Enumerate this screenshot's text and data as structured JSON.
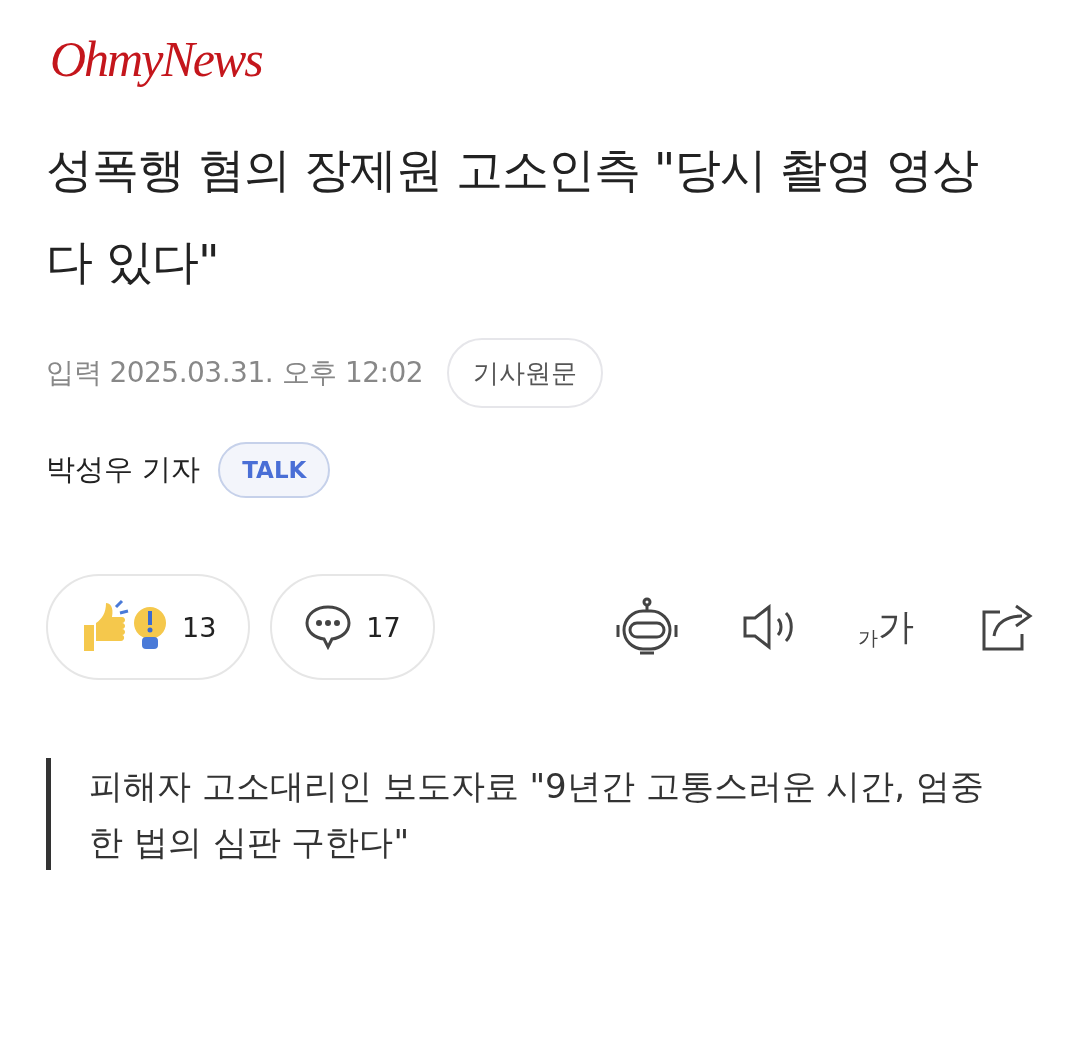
{
  "logo": "OhmyNews",
  "headline": "성폭행 혐의 장제원 고소인측 \"당시 촬영 영상 다 있다\"",
  "meta": {
    "published": "입력 2025.03.31. 오후 12:02",
    "original_button": "기사원문"
  },
  "byline": {
    "author": "박성우 기자",
    "talk_button": "TALK"
  },
  "actions": {
    "reactions": "13",
    "comments": "17",
    "font_size": {
      "small": "가",
      "large": "가"
    }
  },
  "subtitle": "피해자 고소대리인 보도자료 \"9년간 고통스러운 시간, 엄중한 법의 심판 구한다\""
}
